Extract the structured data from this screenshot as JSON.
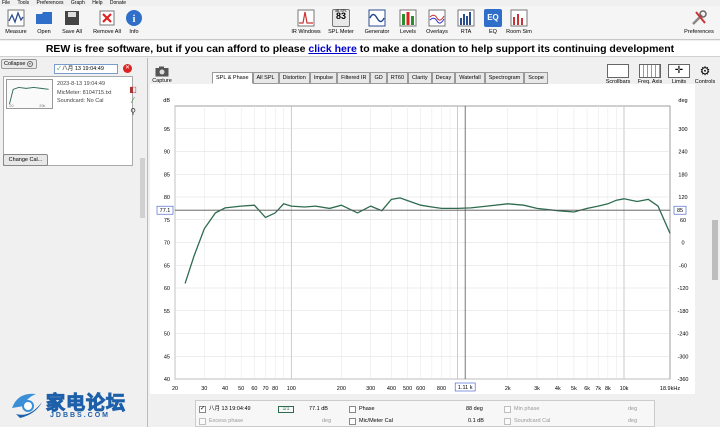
{
  "menu": [
    "File",
    "Tools",
    "Preferences",
    "Graph",
    "Help",
    "Donate"
  ],
  "toolbar": {
    "measure": "Measure",
    "open": "Open",
    "save_all": "Save All",
    "remove_all": "Remove All",
    "info": "Info",
    "ir_windows": "IR Windows",
    "spl_meter": "SPL Meter",
    "spl_value": "83",
    "spl_small": "dB SPL",
    "generator": "Generator",
    "levels": "Levels",
    "overlays": "Overlays",
    "rta": "RTA",
    "eq": "EQ",
    "room_sim": "Room Sim",
    "preferences": "Preferences"
  },
  "banner": {
    "pre": "REW is free software, but if you can afford to please ",
    "link": "click here",
    "post": " to make a donation to help support its continuing development"
  },
  "left": {
    "collapse": "Collapse",
    "meas_name": "八月 13 19:04:49",
    "date": "2023-8-13 19:04:49",
    "mic": "MicMeter: 8104715.txt",
    "soundcard": "Soundcard: No Cal",
    "change_cal": "Change Cal..."
  },
  "tabs": [
    "SPL & Phase",
    "All SPL",
    "Distortion",
    "Impulse",
    "Filtered IR",
    "GD",
    "RT60",
    "Clarity",
    "Decay",
    "Waterfall",
    "Spectrogram",
    "Scope"
  ],
  "capture": "Capture",
  "right_tools": {
    "scrollbars": "Scrollbars",
    "freq_axis": "Freq. Axis",
    "limits": "Limits",
    "controls": "Controls"
  },
  "cursor": {
    "left_value": "77.1",
    "right_value": "85",
    "freq": "1.11 k"
  },
  "legend": {
    "row1": {
      "name": "八月 13 19:04:49",
      "value": "77.1 dB",
      "phase": "Phase",
      "phase_val": "88 deg",
      "min_phase": "Min phase",
      "deg": "deg"
    },
    "row2": {
      "excess": "Excess phase",
      "deg": "deg",
      "mic": "Mic/Meter Cal",
      "mic_val": "0.1 dB",
      "sc": "Soundcard Cal",
      "deg2": "deg"
    }
  },
  "watermark": {
    "cn": "家电论坛",
    "en": "JDBBS.COM"
  },
  "colors": {
    "trace": "#2e6b4f",
    "cursor": "#555555"
  },
  "chart_data": {
    "type": "line",
    "xlabel": "",
    "ylabel": "dB",
    "y2label": "deg",
    "x_scale": "log",
    "xlim": [
      20,
      18900
    ],
    "ylim": [
      40,
      100
    ],
    "y2lim": [
      -360,
      360
    ],
    "x_ticks": [
      "20",
      "30",
      "40",
      "50",
      "60",
      "70",
      "80",
      "100",
      "200",
      "300",
      "400",
      "500",
      "600",
      "800",
      "1k",
      "2k",
      "3k",
      "4k",
      "5k",
      "6k",
      "7k",
      "8k",
      "10k",
      "18.9kHz"
    ],
    "x_tick_values": [
      20,
      30,
      40,
      50,
      60,
      70,
      80,
      100,
      200,
      300,
      400,
      500,
      600,
      800,
      1000,
      2000,
      3000,
      4000,
      5000,
      6000,
      7000,
      8000,
      10000,
      18900
    ],
    "y_ticks": [
      40,
      45,
      50,
      55,
      60,
      65,
      70,
      75,
      80,
      85,
      90,
      95
    ],
    "y2_ticks": [
      -360,
      -300,
      -240,
      -180,
      -120,
      -60,
      0,
      60,
      120,
      180,
      240,
      300
    ],
    "grid": true,
    "cursor_x": 1110,
    "cursor_y": 77.1,
    "series": [
      {
        "x": [
          23,
          26,
          30,
          35,
          40,
          50,
          60,
          70,
          80,
          90,
          100,
          120,
          140,
          170,
          200,
          250,
          300,
          350,
          400,
          450,
          500,
          600,
          700,
          800,
          1000,
          1200,
          1500,
          2000,
          2500,
          3000,
          4000,
          5000,
          6000,
          7000,
          8000,
          9000,
          10000,
          12000,
          14000,
          16000,
          18900
        ],
        "y": [
          61,
          67,
          73,
          76.5,
          77.6,
          78,
          78.2,
          75.5,
          76.5,
          78.5,
          78,
          77.8,
          78,
          77.5,
          78.2,
          76.5,
          78,
          77,
          79.5,
          79.8,
          79.2,
          78.2,
          77.8,
          77.5,
          77.5,
          77.6,
          78,
          78.5,
          78.2,
          77.5,
          77,
          76.7,
          77.5,
          78,
          78.5,
          79.3,
          79.6,
          79,
          79.5,
          78,
          72
        ]
      }
    ]
  }
}
